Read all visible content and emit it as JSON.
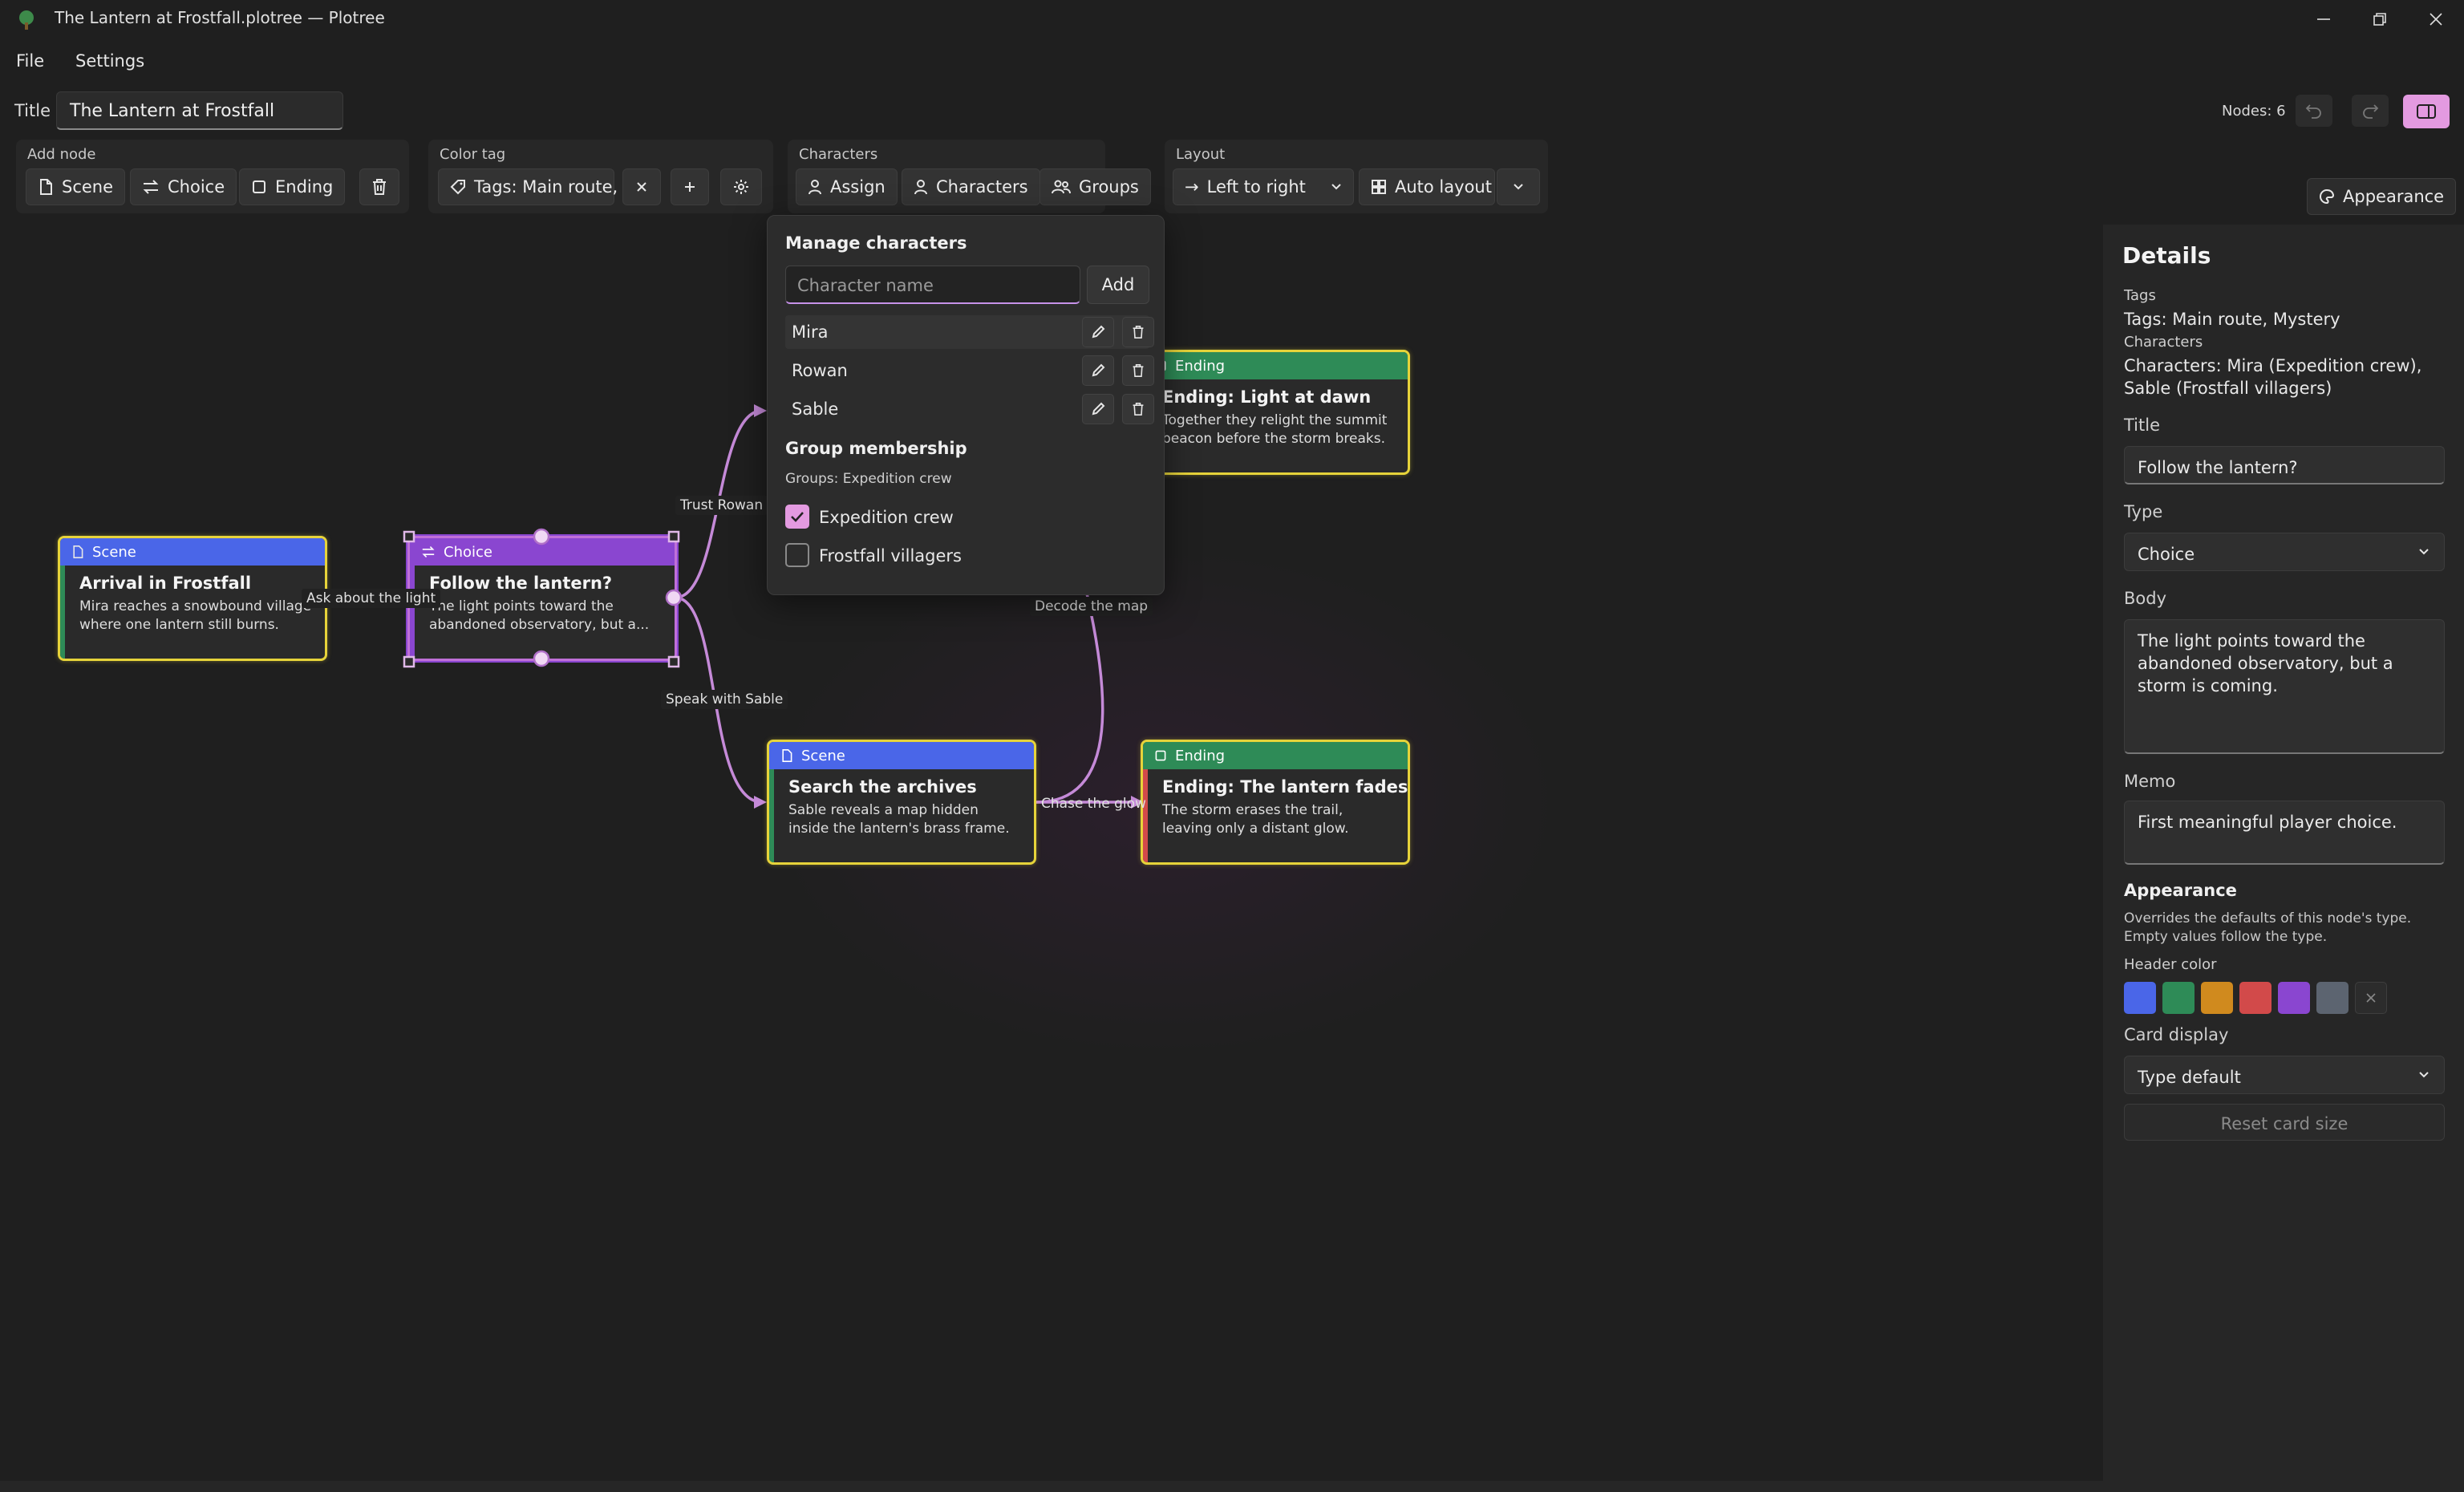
{
  "window": {
    "title": "The Lantern at Frostfall.plotree — Plotree"
  },
  "menu": {
    "file": "File",
    "settings": "Settings"
  },
  "title_bar": {
    "label": "Title",
    "value": "The Lantern at Frostfall",
    "nodes_count": "Nodes: 6"
  },
  "toolbar": {
    "add_node": {
      "title": "Add node",
      "scene": "Scene",
      "choice": "Choice",
      "ending": "Ending"
    },
    "color_tag": {
      "title": "Color tag",
      "tags_value": "Tags: Main route,"
    },
    "characters": {
      "title": "Characters",
      "assign": "Assign",
      "characters": "Characters",
      "groups": "Groups"
    },
    "layout": {
      "title": "Layout",
      "direction": "Left to right",
      "auto": "Auto layout"
    },
    "appearance": "Appearance"
  },
  "manage_characters": {
    "title": "Manage characters",
    "input_placeholder": "Character name",
    "add_label": "Add",
    "characters": [
      "Mira",
      "Rowan",
      "Sable"
    ],
    "group_membership_title": "Group membership",
    "groups_summary": "Groups: Expedition crew",
    "groups": [
      {
        "name": "Expedition crew",
        "checked": true
      },
      {
        "name": "Frostfall villagers",
        "checked": false
      }
    ]
  },
  "nodes": {
    "arrival": {
      "type": "Scene",
      "title": "Arrival in Frostfall",
      "body": "Mira reaches a snowbound village where one lantern still burns."
    },
    "follow": {
      "type": "Choice",
      "title": "Follow the lantern?",
      "body": "The light points toward the abandoned observatory, but a..."
    },
    "dawn": {
      "type": "Ending",
      "title": "Ending: Light at dawn",
      "body": "Together they relight the summit beacon before the storm breaks."
    },
    "archives": {
      "type": "Scene",
      "title": "Search the archives",
      "body": "Sable reveals a map hidden inside the lantern's brass frame."
    },
    "fades": {
      "type": "Ending",
      "title": "Ending: The lantern fades",
      "body": "The storm erases the trail, leaving only a distant glow."
    }
  },
  "edges": {
    "ask_about": "Ask about the light",
    "trust_rowan": "Trust Rowan",
    "speak_sable": "Speak with Sable",
    "decode_map": "Decode the map",
    "chase_glow": "Chase the glow"
  },
  "details": {
    "heading": "Details",
    "tags_label": "Tags",
    "tags_value": "Tags: Main route, Mystery",
    "characters_label": "Characters",
    "characters_value": "Characters: Mira (Expedition crew), Sable (Frostfall villagers)",
    "title_label": "Title",
    "title_value": "Follow the lantern?",
    "type_label": "Type",
    "type_value": "Choice",
    "body_label": "Body",
    "body_value": "The light points toward the abandoned observatory, but a storm is coming.",
    "memo_label": "Memo",
    "memo_value": "First meaningful player choice.",
    "appearance_heading": "Appearance",
    "appearance_desc": "Overrides the defaults of this node's type. Empty values follow the type.",
    "header_color_label": "Header color",
    "swatches": [
      "#4a66e8",
      "#2e8b57",
      "#d08a1e",
      "#d24a4a",
      "#8a46d0",
      "#5c6470"
    ],
    "card_display_label": "Card display",
    "card_display_value": "Type default",
    "reset_label": "Reset card size"
  },
  "colors": {
    "scene": "#4a66e8",
    "choice": "#8a46d0",
    "ending": "#2e8b57",
    "selection": "#e6d33a",
    "edge": "#c58ad8",
    "accent": "#e39ae0"
  }
}
